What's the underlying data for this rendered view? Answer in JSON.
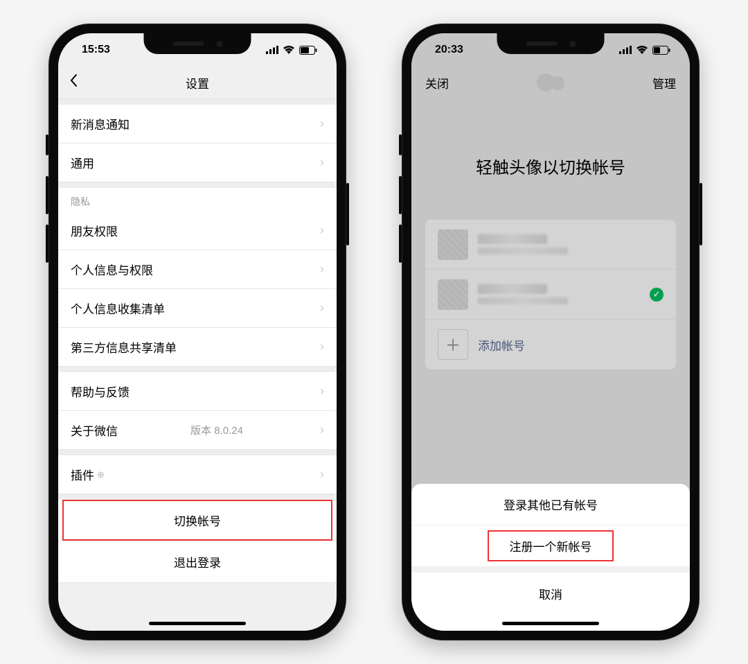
{
  "phone1": {
    "status": {
      "time": "15:53"
    },
    "nav": {
      "title": "设置"
    },
    "rows": {
      "new_message": "新消息通知",
      "general": "通用",
      "privacy_header": "隐私",
      "friends_perm": "朋友权限",
      "personal_info_perm": "个人信息与权限",
      "personal_info_collect": "个人信息收集清单",
      "thirdparty_share": "第三方信息共享清单",
      "help_feedback": "帮助与反馈",
      "about": "关于微信",
      "about_version": "版本 8.0.24",
      "plugins": "插件",
      "switch_account": "切换帐号",
      "logout": "退出登录"
    }
  },
  "phone2": {
    "status": {
      "time": "20:33"
    },
    "nav": {
      "close": "关闭",
      "manage": "管理"
    },
    "headline": "轻触头像以切换帐号",
    "add_account": "添加帐号",
    "sheet": {
      "login_existing": "登录其他已有帐号",
      "register_new": "注册一个新帐号",
      "cancel": "取消"
    }
  }
}
